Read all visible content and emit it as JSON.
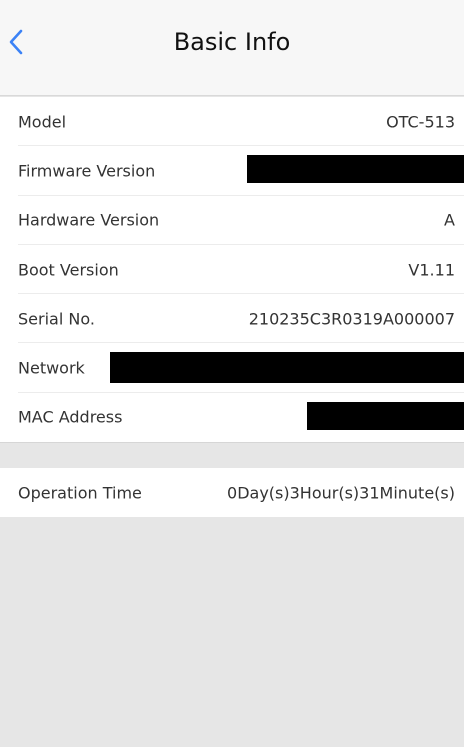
{
  "header": {
    "title": "Basic Info",
    "back_icon": "chevron-left-icon",
    "accent_color": "#3b82f6"
  },
  "info": {
    "model_label": "Model",
    "model_value": "OTC-513",
    "firmware_label": "Firmware Version",
    "hardware_label": "Hardware Version",
    "hardware_value": "A",
    "boot_label": "Boot Version",
    "boot_value": "V1.11",
    "serial_label": "Serial No.",
    "serial_value": "210235C3R0319A000007",
    "network_label": "Network",
    "mac_label": "MAC Address"
  },
  "stats": {
    "operation_label": "Operation Time",
    "operation_value": "0Day(s)3Hour(s)31Minute(s)"
  }
}
